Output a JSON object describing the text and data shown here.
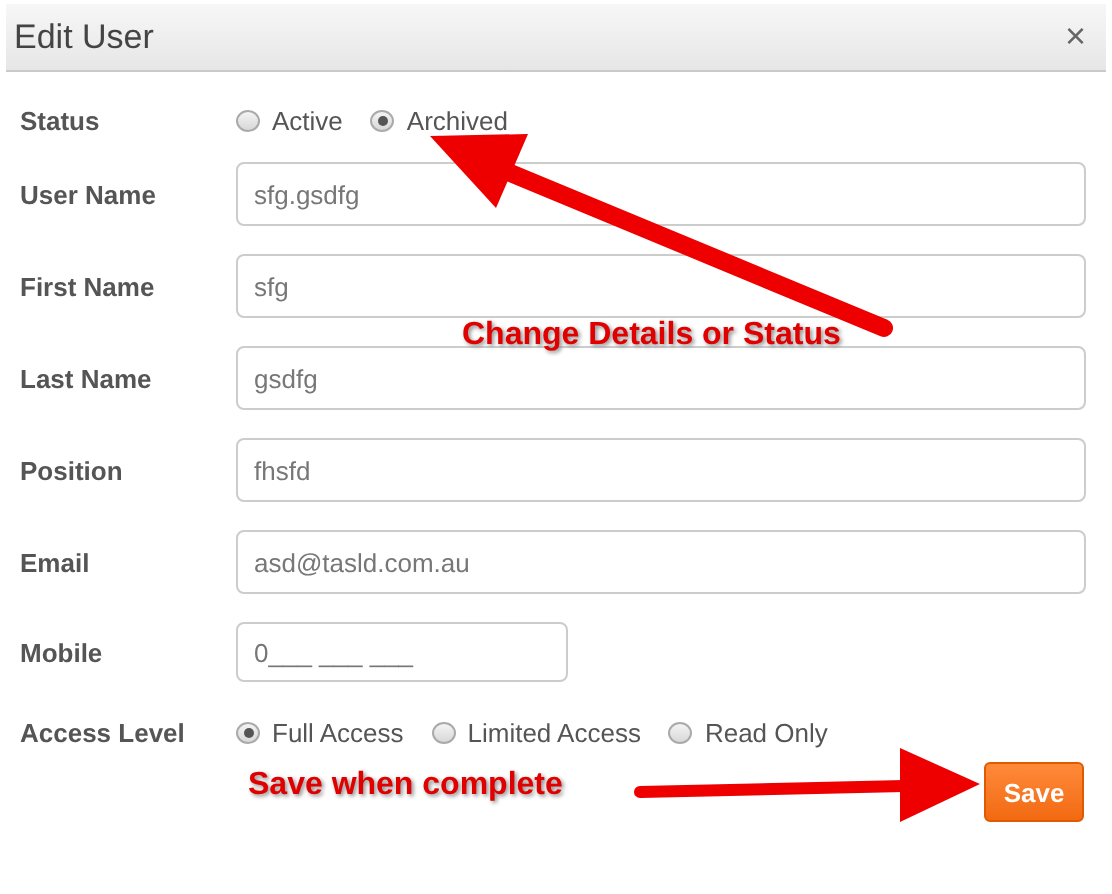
{
  "window": {
    "title": "Edit User",
    "close": "×"
  },
  "rows": [
    {
      "kind": "radio",
      "label": "Status",
      "options": [
        {
          "label": "Active",
          "selected": false
        },
        {
          "label": "Archived",
          "selected": true
        }
      ]
    },
    {
      "kind": "text",
      "label": "User Name",
      "value": "sfg.gsdfg"
    },
    {
      "kind": "text",
      "label": "First Name",
      "value": "sfg"
    },
    {
      "kind": "text",
      "label": "Last Name",
      "value": "gsdfg"
    },
    {
      "kind": "text",
      "label": "Position",
      "value": "fhsfd"
    },
    {
      "kind": "text",
      "label": "Email",
      "value": "asd@tasld.com.au"
    },
    {
      "kind": "phone",
      "label": "Mobile",
      "value": "0___ ___ ___"
    },
    {
      "kind": "radio",
      "label": "Access Level",
      "options": [
        {
          "label": "Full Access",
          "selected": true
        },
        {
          "label": "Limited Access",
          "selected": false
        },
        {
          "label": "Read Only",
          "selected": false
        }
      ]
    }
  ],
  "save_button": "Save",
  "annotations": [
    "Change Details or Status",
    "Save when complete"
  ]
}
